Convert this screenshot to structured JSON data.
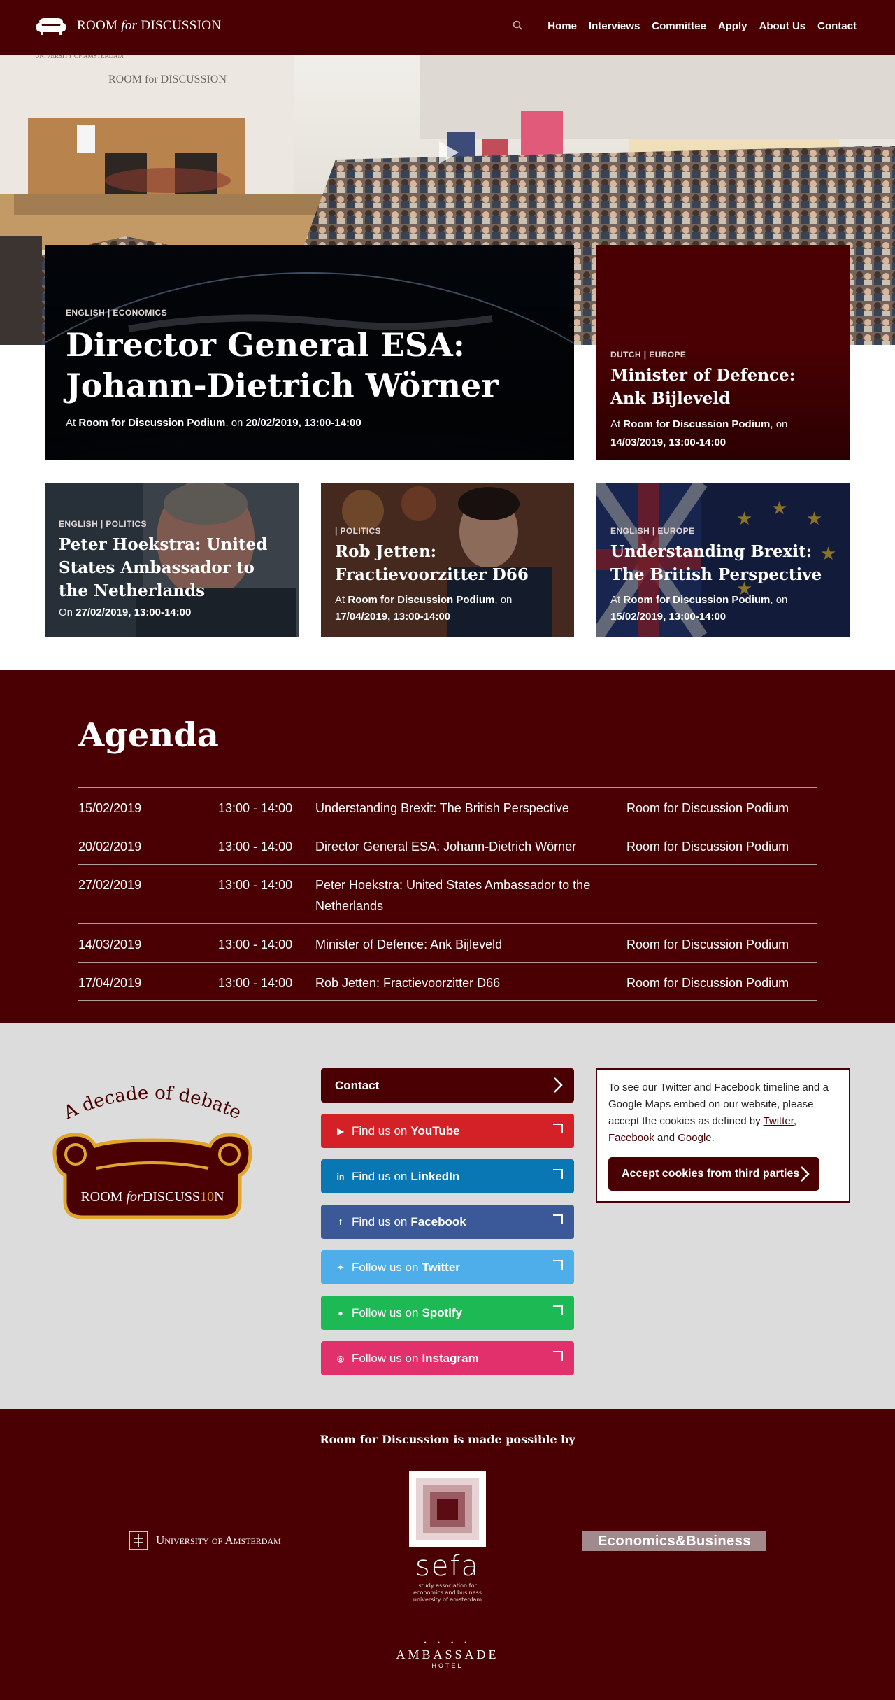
{
  "header": {
    "brand_part1": "ROOM",
    "brand_italic": "for",
    "brand_part2": "DISCUSSION",
    "nav": [
      "Home",
      "Interviews",
      "Committee",
      "Apply",
      "About Us",
      "Contact"
    ]
  },
  "featured": {
    "main": {
      "category": "ENGLISH | ECONOMICS",
      "title": "Director General ESA: Johann-Dietrich Wörner",
      "meta_prefix": "At",
      "venue": "Room for Discussion Podium",
      "meta_mid": ", on",
      "date": "20/02/2019, 13:00-14:00"
    },
    "side": {
      "category": "DUTCH | EUROPE",
      "title": "Minister of Defence: Ank Bijleveld",
      "meta_prefix": "At",
      "venue": "Room for Discussion Podium",
      "meta_mid": ", on",
      "date": "14/03/2019, 13:00-14:00"
    },
    "cards": [
      {
        "category": "ENGLISH | POLITICS",
        "title": "Peter Hoekstra: United States Ambassador to the Netherlands",
        "meta_prefix": "On",
        "date": "27/02/2019, 13:00-14:00"
      },
      {
        "category": "| POLITICS",
        "title": "Rob Jetten: Fractievoorzitter D66",
        "meta_prefix": "At",
        "venue": "Room for Discussion Podium",
        "meta_mid": ", on",
        "date": "17/04/2019, 13:00-14:00"
      },
      {
        "category": "ENGLISH | EUROPE",
        "title": "Understanding Brexit: The British Perspective",
        "meta_prefix": "At",
        "venue": "Room for Discussion Podium",
        "meta_mid": ", on",
        "date": "15/02/2019, 13:00-14:00"
      }
    ]
  },
  "agenda": {
    "title": "Agenda",
    "rows": [
      {
        "date": "15/02/2019",
        "time": "13:00 - 14:00",
        "name": "Understanding Brexit: The British Perspective",
        "location": "Room for Discussion Podium"
      },
      {
        "date": "20/02/2019",
        "time": "13:00 - 14:00",
        "name": "Director General ESA: Johann-Dietrich Wörner",
        "location": "Room for Discussion Podium"
      },
      {
        "date": "27/02/2019",
        "time": "13:00 - 14:00",
        "name": "Peter Hoekstra: United States Ambassador to the Netherlands",
        "location": ""
      },
      {
        "date": "14/03/2019",
        "time": "13:00 - 14:00",
        "name": "Minister of Defence: Ank Bijleveld",
        "location": "Room for Discussion Podium"
      },
      {
        "date": "17/04/2019",
        "time": "13:00 - 14:00",
        "name": "Rob Jetten: Fractievoorzitter D66",
        "location": "Room for Discussion Podium"
      }
    ]
  },
  "social": {
    "logo_arc": "A decade of debate",
    "logo_room": "ROOM",
    "logo_for": "for",
    "logo_disc1": "DISCUSS",
    "logo_ten": "10",
    "logo_n": "N",
    "contact_label": "Contact",
    "buttons": [
      {
        "prefix": "Find us on",
        "service": "YouTube",
        "color": "#d42127",
        "icon": "youtube-icon"
      },
      {
        "prefix": "Find us on",
        "service": "LinkedIn",
        "color": "#0a77b5",
        "icon": "linkedin-icon"
      },
      {
        "prefix": "Find us on",
        "service": "Facebook",
        "color": "#3b5998",
        "icon": "facebook-icon"
      },
      {
        "prefix": "Follow us on",
        "service": "Twitter",
        "color": "#4eaeea",
        "icon": "twitter-icon"
      },
      {
        "prefix": "Follow us on",
        "service": "Spotify",
        "color": "#1db954",
        "icon": "spotify-icon"
      },
      {
        "prefix": "Follow us on",
        "service": "Instagram",
        "color": "#e1306c",
        "icon": "instagram-icon"
      }
    ],
    "cookie_text_1": "To see our Twitter and Facebook timeline and a Google Maps embed on our website, please accept the cookies as defined by",
    "cookie_link_twitter": "Twitter",
    "cookie_link_facebook": "Facebook",
    "cookie_and": "and",
    "cookie_link_google": "Google",
    "cookie_button": "Accept cookies from third parties"
  },
  "sponsors": {
    "heading": "Room for Discussion is made possible by",
    "uva": "University of Amsterdam",
    "sefa": "sefa",
    "sefa_sub": [
      "study association for",
      "economics and business",
      "university of amsterdam"
    ],
    "eb": "Economics&Business",
    "ambassade": "AMBASSADE",
    "hotel": "HOTEL"
  },
  "colors": {
    "brand": "#4a0003",
    "gold": "#e0a52a"
  }
}
